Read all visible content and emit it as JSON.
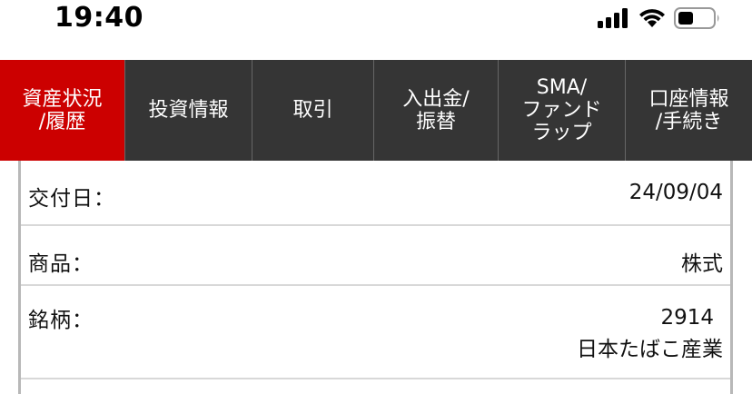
{
  "status_bar": {
    "time": "19:40",
    "icons": [
      "cellular-signal-icon",
      "wifi-icon",
      "battery-icon"
    ]
  },
  "nav": {
    "tabs": [
      {
        "label": "資産状況\n/履歴",
        "active": true
      },
      {
        "label": "投資情報",
        "active": false
      },
      {
        "label": "取引",
        "active": false
      },
      {
        "label": "入出金/\n振替",
        "active": false
      },
      {
        "label": "SMA/\nファンド\nラップ",
        "active": false
      },
      {
        "label": "口座情報\n/手続き",
        "active": false
      }
    ],
    "active_color": "#cc0000",
    "bg_color": "#353535"
  },
  "details": {
    "delivery_date": {
      "label": "交付日：",
      "value": "24/09/04"
    },
    "product": {
      "label": "商品：",
      "value": "株式"
    },
    "stock": {
      "label": "銘柄：",
      "code": "2914",
      "name": "日本たばこ産業"
    }
  }
}
